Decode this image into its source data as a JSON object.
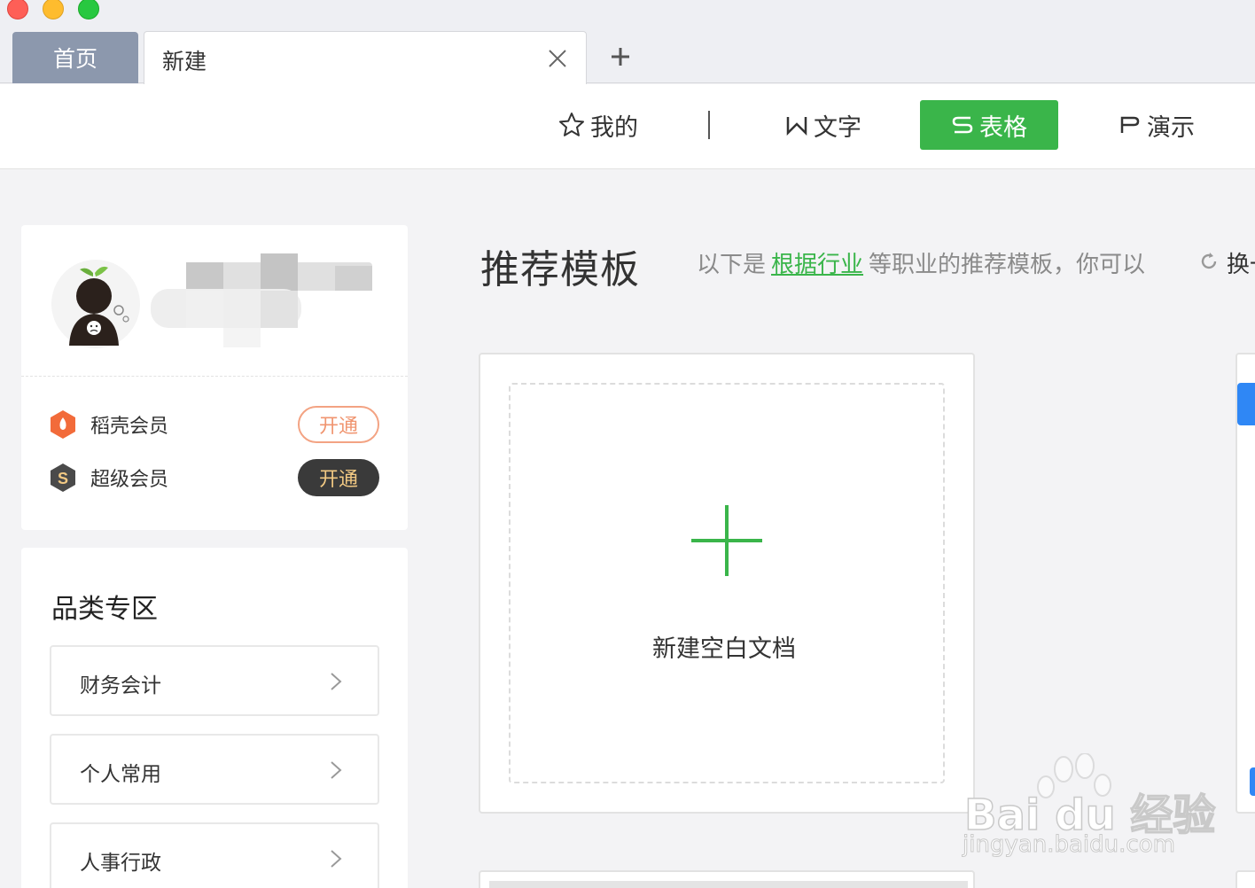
{
  "window": {
    "tabs": [
      {
        "label": "首页"
      },
      {
        "label": "新建"
      }
    ]
  },
  "toolbar": {
    "mine_label": "我的",
    "word_label": "文字",
    "sheet_label": "表格",
    "present_label": "演示",
    "active_color": "#3ab54a"
  },
  "profile": {
    "members": [
      {
        "label": "稻壳会员",
        "button": "开通"
      },
      {
        "label": "超级会员",
        "button": "开通"
      }
    ]
  },
  "categories": {
    "title": "品类专区",
    "items": [
      {
        "label": "财务会计"
      },
      {
        "label": "个人常用"
      },
      {
        "label": "人事行政"
      }
    ]
  },
  "main": {
    "title": "推荐模板",
    "desc_prefix": "以下是",
    "desc_link": "根据行业",
    "desc_suffix": "等职业的推荐模板，你可以",
    "refresh_label": "换一",
    "blank_doc_label": "新建空白文档"
  },
  "watermark": {
    "line1": "Bai du 经验",
    "line2": "jingyan.baidu.com"
  }
}
